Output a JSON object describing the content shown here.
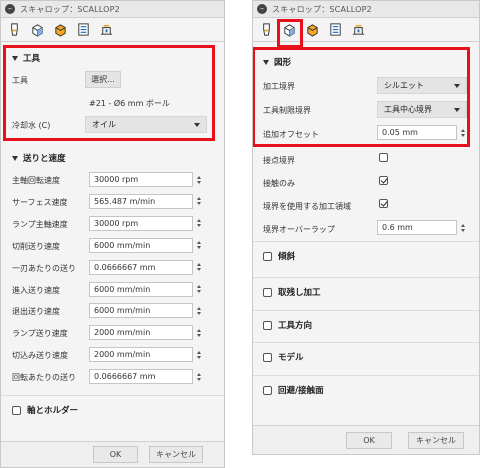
{
  "left": {
    "title": "スキャロップ：SCALLOP2",
    "tool_section": {
      "header": "工具",
      "tool_label": "工具",
      "select_button": "選択...",
      "tool_desc": "#21 - Ø6 mm ボール",
      "coolant_label": "冷却水 (C)",
      "coolant_value": "オイル"
    },
    "feed_section": {
      "header": "送りと速度",
      "rows": [
        {
          "label": "主軸回転速度",
          "value": "30000 rpm"
        },
        {
          "label": "サーフェス速度",
          "value": "565.487 m/min"
        },
        {
          "label": "ランプ主軸速度",
          "value": "30000 rpm"
        },
        {
          "label": "切削送り速度",
          "value": "6000 mm/min"
        },
        {
          "label": "一刃あたりの送り",
          "value": "0.0666667 mm"
        },
        {
          "label": "進入送り速度",
          "value": "6000 mm/min"
        },
        {
          "label": "退出送り速度",
          "value": "6000 mm/min"
        },
        {
          "label": "ランプ送り速度",
          "value": "2000 mm/min"
        },
        {
          "label": "切込み送り速度",
          "value": "2000 mm/min"
        },
        {
          "label": "回転あたりの送り",
          "value": "0.0666667 mm"
        }
      ]
    },
    "shaft_section": {
      "header": "軸とホルダー"
    },
    "ok": "OK",
    "cancel": "キャンセル"
  },
  "right": {
    "title": "スキャロップ：SCALLOP2",
    "shape_section": {
      "header": "図形",
      "machining_boundary_label": "加工境界",
      "machining_boundary_value": "シルエット",
      "tool_containment_label": "工具制限境界",
      "tool_containment_value": "工具中心境界",
      "offset_label": "追加オフセット",
      "offset_value": "0.05 mm"
    },
    "contact_point_label": "接点境界",
    "contact_only_label": "接触のみ",
    "stock_contour_label": "境界を使用する加工領域",
    "overlap_label": "境界オーバーラップ",
    "overlap_value": "0.6 mm",
    "sections": [
      "傾斜",
      "取残し加工",
      "工具方向",
      "モデル",
      "回避/接触面"
    ],
    "ok": "OK",
    "cancel": "キャンセル"
  },
  "colors": {
    "highlight": "#e8101a",
    "panel_bg": "#f4f4f4"
  }
}
